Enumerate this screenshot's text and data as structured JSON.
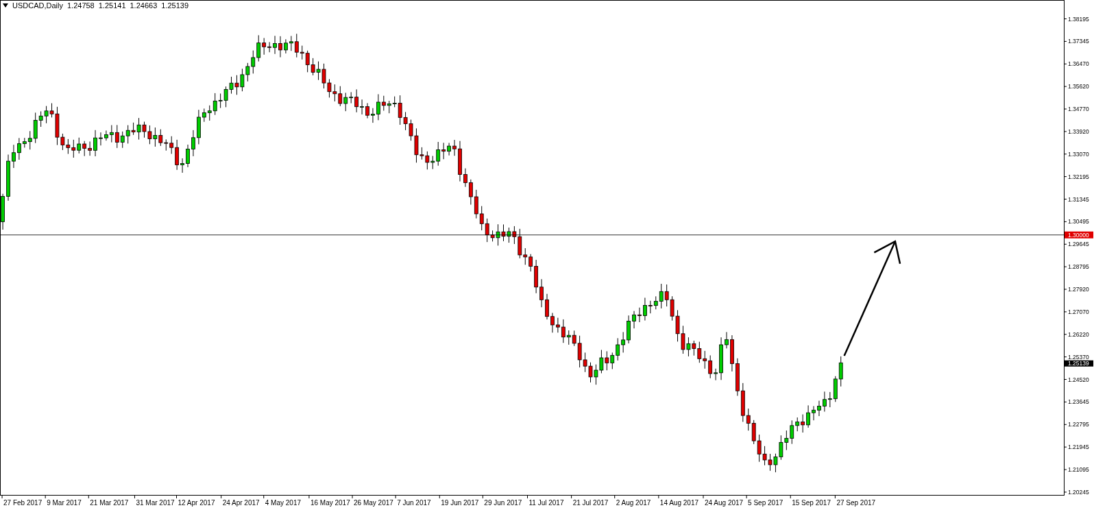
{
  "header": {
    "symbol": "USDCAD,Daily",
    "quotes": [
      "1.24758",
      "1.25141",
      "1.24663",
      "1.25139"
    ]
  },
  "price_axis": [
    "1.38195",
    "1.37345",
    "1.36470",
    "1.35620",
    "1.34770",
    "1.33920",
    "1.33070",
    "1.32195",
    "1.31345",
    "1.30495",
    "1.29645",
    "1.28795",
    "1.27920",
    "1.27070",
    "1.26220",
    "1.25370",
    "1.24520",
    "1.23645",
    "1.22795",
    "1.21945",
    "1.21095",
    "1.20245"
  ],
  "level_line": {
    "label": "1.30000"
  },
  "current_price": {
    "label": "1.25139"
  },
  "date_axis": [
    "27 Feb 2017",
    "9 Mar 2017",
    "21 Mar 2017",
    "31 Mar 2017",
    "12 Apr 2017",
    "24 Apr 2017",
    "4 May 2017",
    "16 May 2017",
    "26 May 2017",
    "7 Jun 2017",
    "19 Jun 2017",
    "29 Jun 2017",
    "11 Jul 2017",
    "21 Jul 2017",
    "2 Aug 2017",
    "14 Aug 2017",
    "24 Aug 2017",
    "5 Sep 2017",
    "15 Sep 2017",
    "27 Sep 2017"
  ]
}
